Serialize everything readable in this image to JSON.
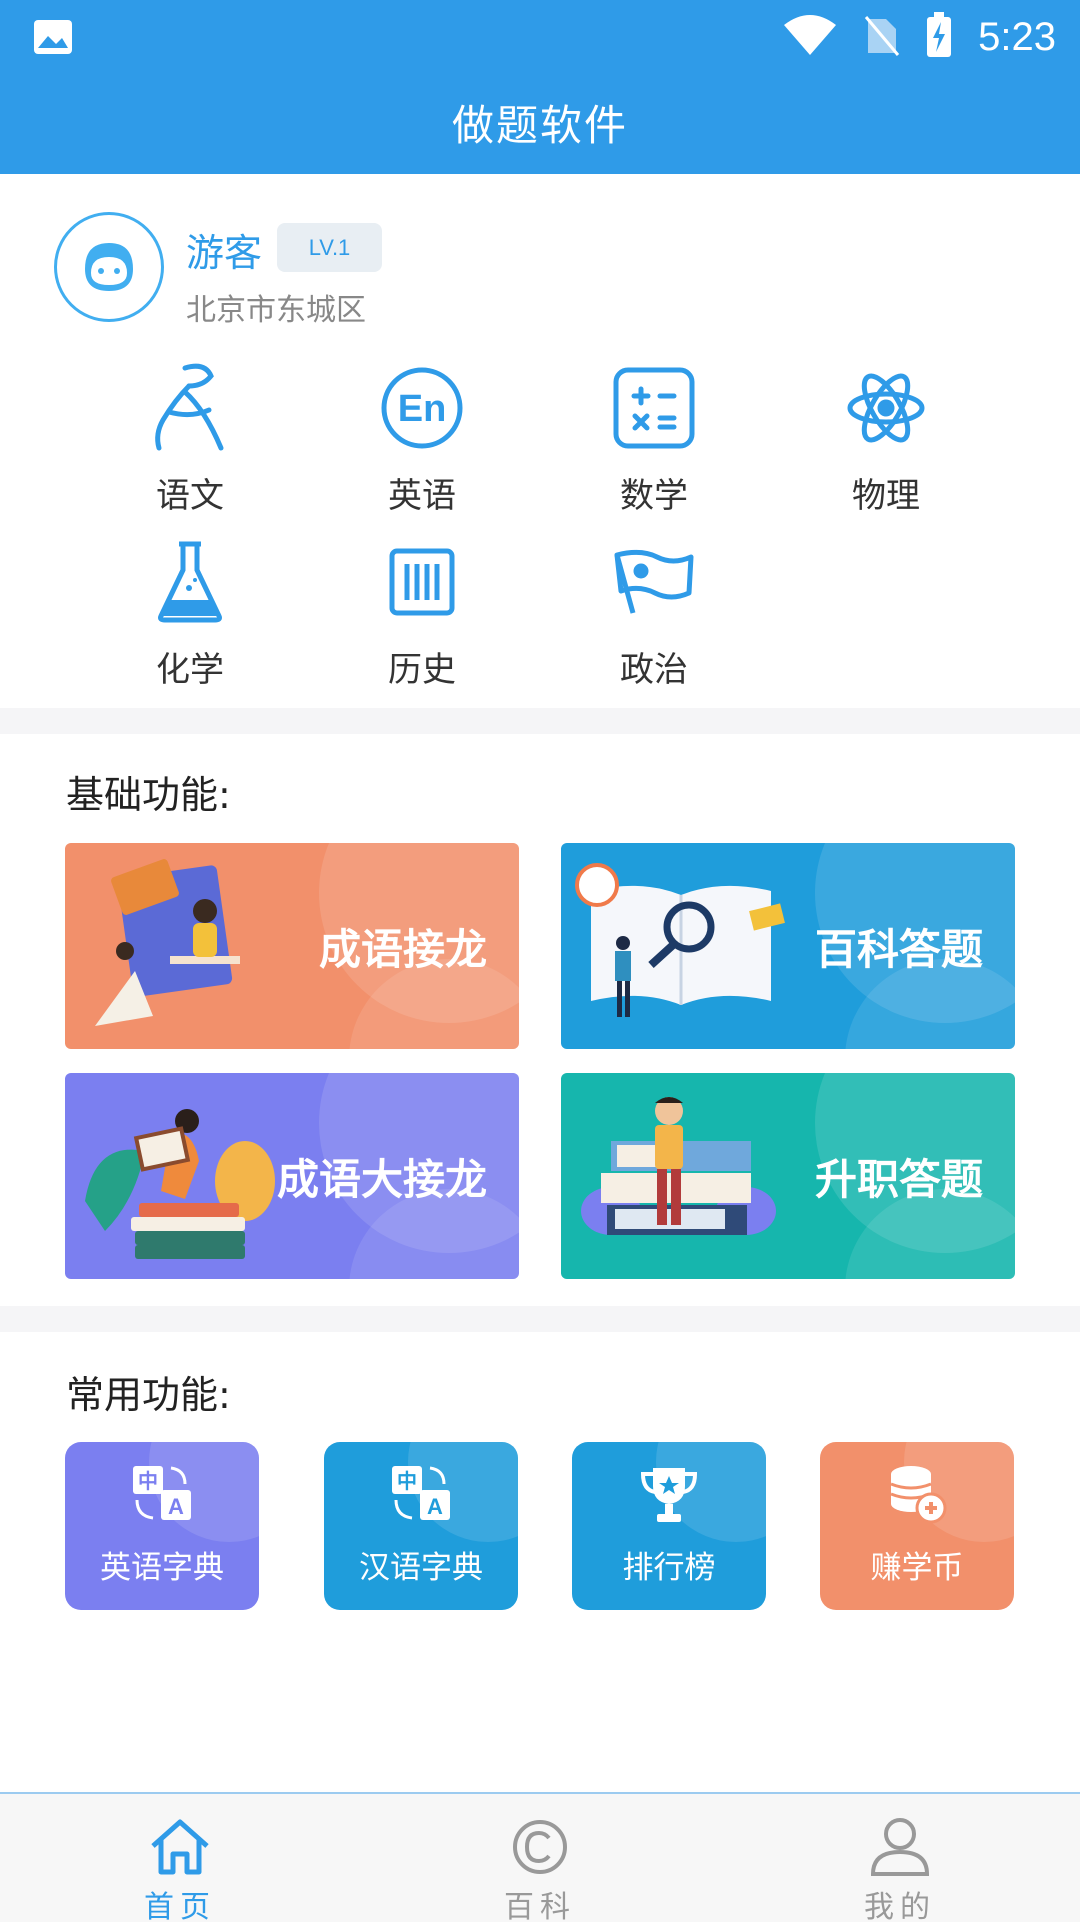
{
  "status_bar": {
    "time": "5:23"
  },
  "header": {
    "title": "做题软件"
  },
  "profile": {
    "name": "游客",
    "level": "LV.1",
    "location": "北京市东城区"
  },
  "subjects": [
    {
      "label": "语文",
      "icon": "chinese-brush-icon"
    },
    {
      "label": "英语",
      "icon": "en-circle-icon"
    },
    {
      "label": "数学",
      "icon": "calculator-icon"
    },
    {
      "label": "物理",
      "icon": "atom-icon"
    },
    {
      "label": "化学",
      "icon": "flask-icon"
    },
    {
      "label": "历史",
      "icon": "history-scroll-icon"
    },
    {
      "label": "政治",
      "icon": "flag-icon"
    }
  ],
  "basic_section": {
    "title": "基础功能:",
    "cards": [
      {
        "label": "成语接龙",
        "color": "#f2906b"
      },
      {
        "label": "百科答题",
        "color": "#1f9ddb"
      },
      {
        "label": "成语大接龙",
        "color": "#7b7ff0"
      },
      {
        "label": "升职答题",
        "color": "#16b6ad"
      }
    ]
  },
  "common_section": {
    "title": "常用功能:",
    "tools": [
      {
        "label": "英语字典",
        "icon": "translate-icon",
        "color": "#7b7ff0"
      },
      {
        "label": "汉语字典",
        "icon": "translate-icon",
        "color": "#1f9ddb"
      },
      {
        "label": "排行榜",
        "icon": "trophy-icon",
        "color": "#1f9ddb"
      },
      {
        "label": "赚学币",
        "icon": "coins-icon",
        "color": "#f2906b"
      }
    ]
  },
  "bottom_nav": {
    "items": [
      {
        "label": "首页",
        "icon": "home-icon",
        "active": true
      },
      {
        "label": "百科",
        "icon": "copyright-icon",
        "active": false
      },
      {
        "label": "我的",
        "icon": "user-icon",
        "active": false
      }
    ]
  },
  "colors": {
    "primary": "#2f9be8",
    "inactive": "#999999"
  }
}
